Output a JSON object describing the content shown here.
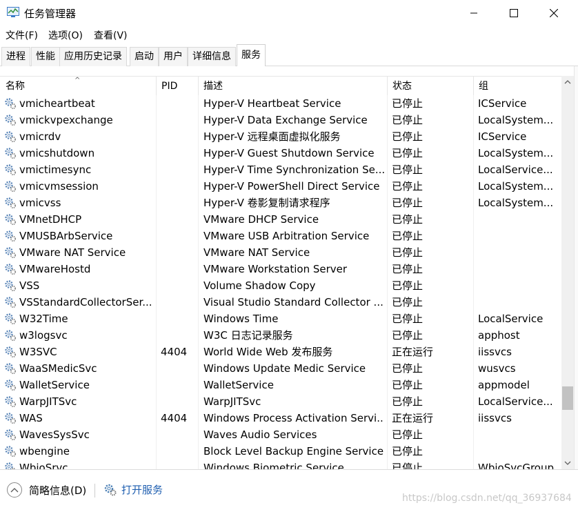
{
  "window": {
    "title": "任务管理器",
    "icon": "task-manager-icon",
    "controls": [
      "minimize-icon",
      "maximize-icon",
      "close-icon"
    ]
  },
  "menu": [
    "文件(F)",
    "选项(O)",
    "查看(V)"
  ],
  "tabs": [
    {
      "label": "进程",
      "active": false
    },
    {
      "label": "性能",
      "active": false
    },
    {
      "label": "应用历史记录",
      "active": false
    },
    {
      "label": "启动",
      "active": false
    },
    {
      "label": "用户",
      "active": false
    },
    {
      "label": "详细信息",
      "active": false
    },
    {
      "label": "服务",
      "active": true
    }
  ],
  "columns": {
    "name": "名称",
    "pid": "PID",
    "desc": "描述",
    "status": "状态",
    "group": "组"
  },
  "rows": [
    {
      "name": "vmicheartbeat",
      "pid": "",
      "desc": "Hyper-V Heartbeat Service",
      "status": "已停止",
      "group": "ICService"
    },
    {
      "name": "vmickvpexchange",
      "pid": "",
      "desc": "Hyper-V Data Exchange Service",
      "status": "已停止",
      "group": "LocalSystem..."
    },
    {
      "name": "vmicrdv",
      "pid": "",
      "desc": "Hyper-V 远程桌面虚拟化服务",
      "status": "已停止",
      "group": "ICService"
    },
    {
      "name": "vmicshutdown",
      "pid": "",
      "desc": "Hyper-V Guest Shutdown Service",
      "status": "已停止",
      "group": "LocalSystem..."
    },
    {
      "name": "vmictimesync",
      "pid": "",
      "desc": "Hyper-V Time Synchronization Se...",
      "status": "已停止",
      "group": "LocalService..."
    },
    {
      "name": "vmicvmsession",
      "pid": "",
      "desc": "Hyper-V PowerShell Direct Service",
      "status": "已停止",
      "group": "LocalSystem..."
    },
    {
      "name": "vmicvss",
      "pid": "",
      "desc": "Hyper-V 卷影复制请求程序",
      "status": "已停止",
      "group": "LocalSystem..."
    },
    {
      "name": "VMnetDHCP",
      "pid": "",
      "desc": "VMware DHCP Service",
      "status": "已停止",
      "group": ""
    },
    {
      "name": "VMUSBArbService",
      "pid": "",
      "desc": "VMware USB Arbitration Service",
      "status": "已停止",
      "group": ""
    },
    {
      "name": "VMware NAT Service",
      "pid": "",
      "desc": "VMware NAT Service",
      "status": "已停止",
      "group": ""
    },
    {
      "name": "VMwareHostd",
      "pid": "",
      "desc": "VMware Workstation Server",
      "status": "已停止",
      "group": ""
    },
    {
      "name": "VSS",
      "pid": "",
      "desc": "Volume Shadow Copy",
      "status": "已停止",
      "group": ""
    },
    {
      "name": "VSStandardCollectorSer...",
      "pid": "",
      "desc": "Visual Studio Standard Collector ...",
      "status": "已停止",
      "group": ""
    },
    {
      "name": "W32Time",
      "pid": "",
      "desc": "Windows Time",
      "status": "已停止",
      "group": "LocalService"
    },
    {
      "name": "w3logsvc",
      "pid": "",
      "desc": "W3C 日志记录服务",
      "status": "已停止",
      "group": "apphost"
    },
    {
      "name": "W3SVC",
      "pid": "4404",
      "desc": "World Wide Web 发布服务",
      "status": "正在运行",
      "group": "iissvcs"
    },
    {
      "name": "WaaSMedicSvc",
      "pid": "",
      "desc": "Windows Update Medic Service",
      "status": "已停止",
      "group": "wusvcs"
    },
    {
      "name": "WalletService",
      "pid": "",
      "desc": "WalletService",
      "status": "已停止",
      "group": "appmodel"
    },
    {
      "name": "WarpJITSvc",
      "pid": "",
      "desc": "WarpJITSvc",
      "status": "已停止",
      "group": "LocalService..."
    },
    {
      "name": "WAS",
      "pid": "4404",
      "desc": "Windows Process Activation Servi...",
      "status": "正在运行",
      "group": "iissvcs"
    },
    {
      "name": "WavesSysSvc",
      "pid": "",
      "desc": "Waves Audio Services",
      "status": "已停止",
      "group": ""
    },
    {
      "name": "wbengine",
      "pid": "",
      "desc": "Block Level Backup Engine Service",
      "status": "已停止",
      "group": ""
    },
    {
      "name": "WbioSrvc",
      "pid": "",
      "desc": "Windows Biometric Service",
      "status": "已停止",
      "group": "WbioSvcGroup"
    }
  ],
  "footer": {
    "fewer_details": "简略信息(D)",
    "open_services": "打开服务"
  },
  "watermark": "https://blog.csdn.net/qq_36937684",
  "colors": {
    "link": "#1f5fb0",
    "gear": "#4a7fb5"
  }
}
